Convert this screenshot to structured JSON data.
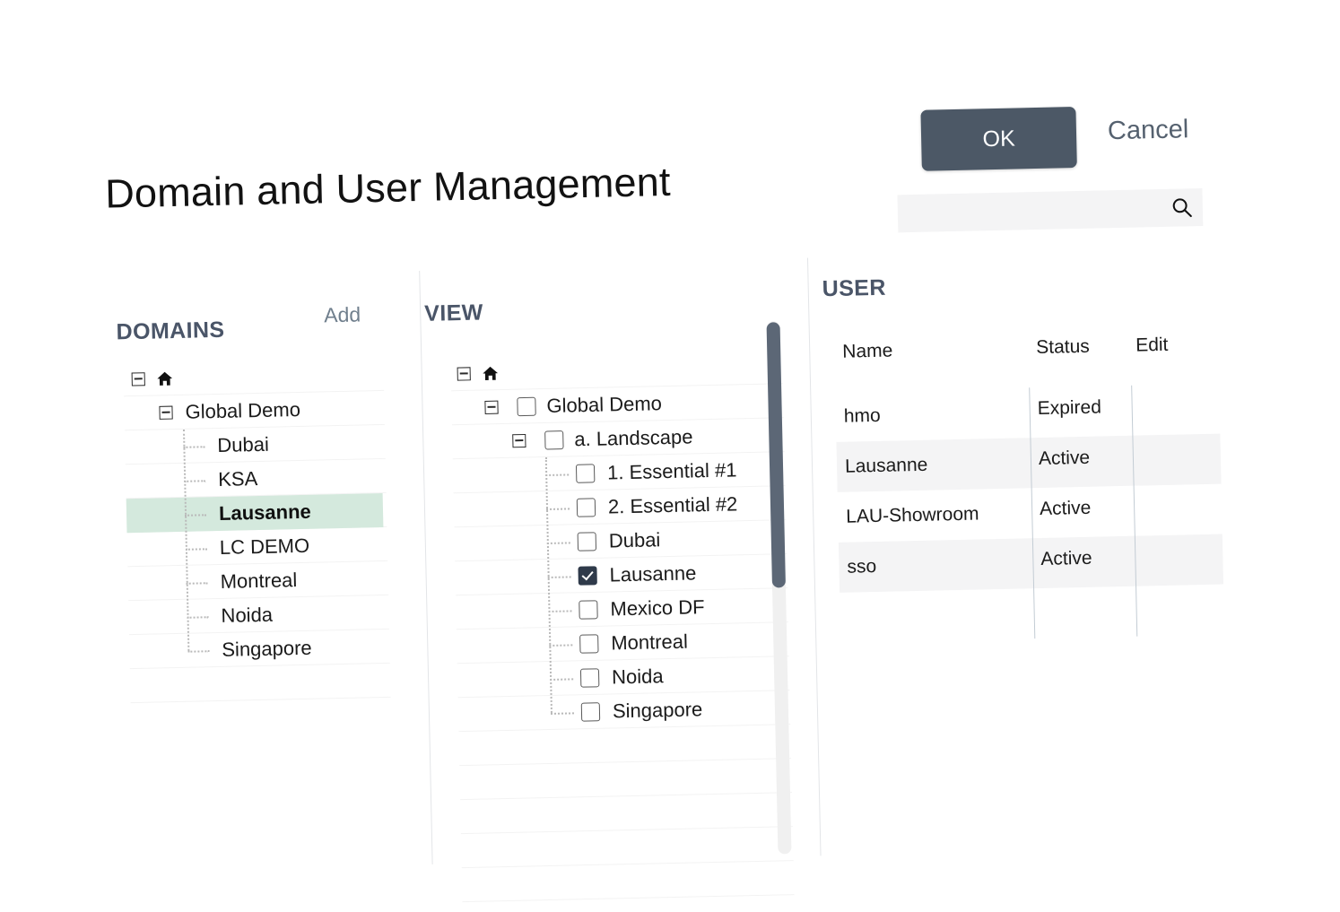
{
  "header": {
    "title": "Domain and User Management",
    "ok_label": "OK",
    "cancel_label": "Cancel"
  },
  "search": {
    "value": "",
    "placeholder": "",
    "icon": "search-icon"
  },
  "domains_panel": {
    "heading": "DOMAINS",
    "add_label": "Add",
    "root_icon": "home-icon",
    "items": [
      {
        "label": "Global Demo",
        "level": 1,
        "expandable": true,
        "selected": false
      },
      {
        "label": "Dubai",
        "level": 2,
        "expandable": false,
        "selected": false
      },
      {
        "label": "KSA",
        "level": 2,
        "expandable": false,
        "selected": false
      },
      {
        "label": "Lausanne",
        "level": 2,
        "expandable": false,
        "selected": true
      },
      {
        "label": "LC DEMO",
        "level": 2,
        "expandable": false,
        "selected": false
      },
      {
        "label": "Montreal",
        "level": 2,
        "expandable": false,
        "selected": false
      },
      {
        "label": "Noida",
        "level": 2,
        "expandable": false,
        "selected": false
      },
      {
        "label": "Singapore",
        "level": 2,
        "expandable": false,
        "selected": false
      }
    ]
  },
  "view_panel": {
    "heading": "VIEW",
    "root_icon": "home-icon",
    "items": [
      {
        "label": "Global Demo",
        "level": 1,
        "expandable": true,
        "checked": false
      },
      {
        "label": "a. Landscape",
        "level": 2,
        "expandable": true,
        "checked": false
      },
      {
        "label": "1. Essential #1",
        "level": 3,
        "expandable": false,
        "checked": false
      },
      {
        "label": "2. Essential #2",
        "level": 3,
        "expandable": false,
        "checked": false
      },
      {
        "label": "Dubai",
        "level": 3,
        "expandable": false,
        "checked": false
      },
      {
        "label": "Lausanne",
        "level": 3,
        "expandable": false,
        "checked": true
      },
      {
        "label": "Mexico DF",
        "level": 3,
        "expandable": false,
        "checked": false
      },
      {
        "label": "Montreal",
        "level": 3,
        "expandable": false,
        "checked": false
      },
      {
        "label": "Noida",
        "level": 3,
        "expandable": false,
        "checked": false
      },
      {
        "label": "Singapore",
        "level": 3,
        "expandable": false,
        "checked": false
      }
    ]
  },
  "user_panel": {
    "heading": "USER",
    "columns": [
      "Name",
      "Status",
      "Edit"
    ],
    "rows": [
      {
        "name": "hmo",
        "status": "Expired",
        "edit": ""
      },
      {
        "name": "Lausanne",
        "status": "Active",
        "edit": ""
      },
      {
        "name": "LAU-Showroom",
        "status": "Active",
        "edit": ""
      },
      {
        "name": "sso",
        "status": "Active",
        "edit": ""
      }
    ]
  },
  "colors": {
    "accent_dark": "#4c5866",
    "selection_green": "#d4e9dd",
    "row_shade": "#f4f4f5",
    "heading": "#4a5568",
    "checkbox_checked": "#2f3a4a"
  }
}
